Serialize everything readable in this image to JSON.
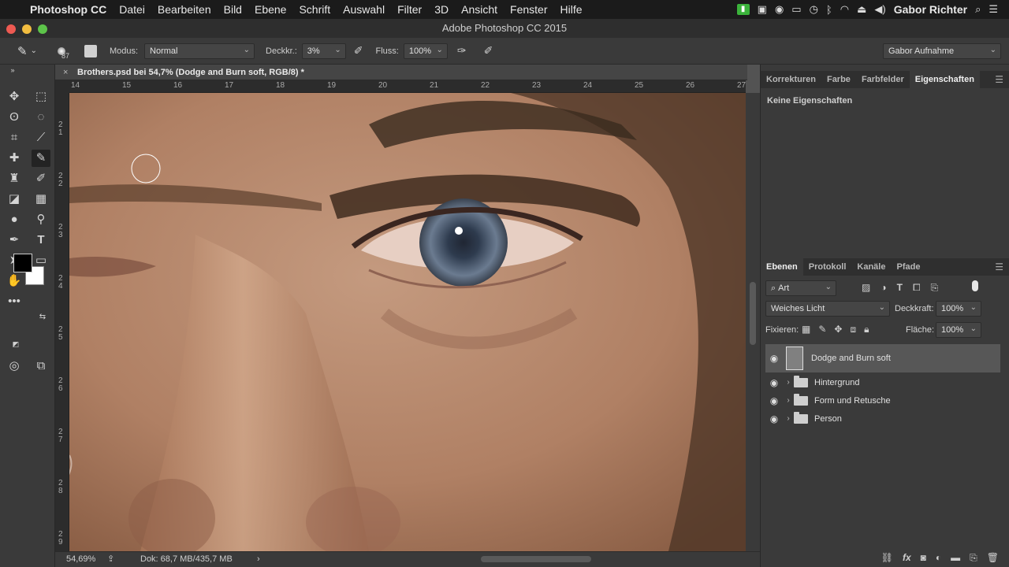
{
  "menubar": {
    "apple": "",
    "app_name": "Photoshop CC",
    "items": [
      "Datei",
      "Bearbeiten",
      "Bild",
      "Ebene",
      "Schrift",
      "Auswahl",
      "Filter",
      "3D",
      "Ansicht",
      "Fenster",
      "Hilfe"
    ],
    "user": "Gabor Richter"
  },
  "window": {
    "title": "Adobe Photoshop CC 2015"
  },
  "options": {
    "brush_size": "87",
    "modus_label": "Modus:",
    "modus_value": "Normal",
    "deckkr_label": "Deckkr.:",
    "deckkr_value": "3%",
    "fluss_label": "Fluss:",
    "fluss_value": "100%",
    "workspace": "Gabor Aufnahme"
  },
  "document": {
    "tab_close": "×",
    "tab_title": "Brothers.psd bei 54,7% (Dodge and Burn soft, RGB/8) *",
    "ruler_top": [
      "14",
      "15",
      "16",
      "17",
      "18",
      "19",
      "20",
      "21",
      "22",
      "23",
      "24",
      "25",
      "26",
      "27"
    ],
    "ruler_left": [
      "2\n1",
      "2\n2",
      "2\n3",
      "2\n4",
      "2\n5",
      "2\n6",
      "2\n7",
      "2\n8",
      "2\n9"
    ]
  },
  "status": {
    "zoom": "54,69%",
    "doc_size": "Dok: 68,7 MB/435,7 MB",
    "arrow": "›"
  },
  "panel_top": {
    "tabs": [
      "Korrekturen",
      "Farbe",
      "Farbfelder",
      "Eigenschaften"
    ],
    "active_tab": "Eigenschaften",
    "empty_text": "Keine Eigenschaften"
  },
  "layers_panel": {
    "tabs": [
      "Ebenen",
      "Protokoll",
      "Kanäle",
      "Pfade"
    ],
    "active_tab": "Ebenen",
    "filter_label": "Art",
    "blend_mode": "Weiches Licht",
    "opacity_label": "Deckkraft:",
    "opacity_value": "100%",
    "lock_label": "Fixieren:",
    "fill_label": "Fläche:",
    "fill_value": "100%",
    "layers": [
      {
        "name": "Dodge and Burn soft",
        "type": "layer",
        "selected": true
      },
      {
        "name": "Hintergrund",
        "type": "group",
        "selected": false
      },
      {
        "name": "Form und Retusche",
        "type": "group",
        "selected": false
      },
      {
        "name": "Person",
        "type": "group",
        "selected": false
      }
    ]
  },
  "bottom_icons": [
    "link-icon",
    "fx-icon",
    "mask-icon",
    "adjustment-icon",
    "folder-icon",
    "new-layer-icon",
    "trash-icon"
  ],
  "colors": {
    "foreground": "#000000",
    "background": "#ffffff",
    "skin": "#b18468"
  }
}
